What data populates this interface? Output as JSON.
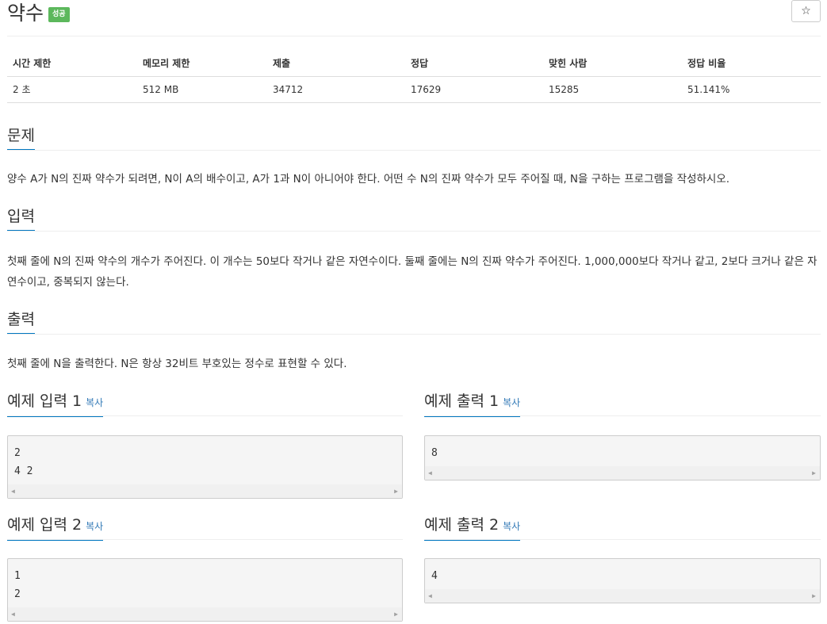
{
  "problem": {
    "title": "약수",
    "badge": "성공",
    "star_icon": "☆"
  },
  "stats": {
    "headers": [
      "시간 제한",
      "메모리 제한",
      "제출",
      "정답",
      "맞힌 사람",
      "정답 비율"
    ],
    "values": [
      "2 초",
      "512 MB",
      "34712",
      "17629",
      "15285",
      "51.141%"
    ]
  },
  "sections": {
    "problem_label": "문제",
    "problem_text": "양수 A가 N의 진짜 약수가 되려면, N이 A의 배수이고, A가 1과 N이 아니어야 한다. 어떤 수 N의 진짜 약수가 모두 주어질 때, N을 구하는 프로그램을 작성하시오.",
    "input_label": "입력",
    "input_text": "첫째 줄에 N의 진짜 약수의 개수가 주어진다. 이 개수는 50보다 작거나 같은 자연수이다. 둘째 줄에는 N의 진짜 약수가 주어진다. 1,000,000보다 작거나 같고, 2보다 크거나 같은 자연수이고, 중복되지 않는다.",
    "output_label": "출력",
    "output_text": "첫째 줄에 N을 출력한다. N은 항상 32비트 부호있는 정수로 표현할 수 있다."
  },
  "samples": {
    "copy_label": "복사",
    "input1_label": "예제 입력 1",
    "input1_value": "2\n4 2",
    "output1_label": "예제 출력 1",
    "output1_value": "8",
    "input2_label": "예제 입력 2",
    "input2_value": "1\n2",
    "output2_label": "예제 출력 2",
    "output2_value": "4"
  },
  "colors": {
    "badge": "#5cb85c",
    "accent_underline": "#0076c0",
    "link": "#337ab7"
  }
}
